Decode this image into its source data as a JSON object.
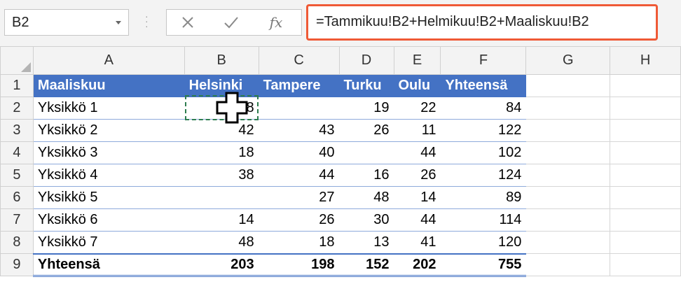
{
  "namebox": {
    "value": "B2"
  },
  "formula_bar": {
    "formula": "=Tammikuu!B2+Helmikuu!B2+Maaliskuu!B2",
    "fx_label": "fx"
  },
  "columns": [
    "A",
    "B",
    "C",
    "D",
    "E",
    "F",
    "G",
    "H"
  ],
  "header_row": {
    "row_num": "1",
    "cells": [
      "Maaliskuu",
      "Helsinki",
      "Tampere",
      "Turku",
      "Oulu",
      "Yhteensä"
    ]
  },
  "rows": [
    {
      "row_num": "2",
      "cells": [
        "Yksikkö 1",
        "8",
        "",
        "19",
        "22",
        "84"
      ]
    },
    {
      "row_num": "3",
      "cells": [
        "Yksikkö 2",
        "42",
        "43",
        "26",
        "11",
        "122"
      ]
    },
    {
      "row_num": "4",
      "cells": [
        "Yksikkö 3",
        "18",
        "40",
        "",
        "44",
        "102"
      ]
    },
    {
      "row_num": "5",
      "cells": [
        "Yksikkö 4",
        "38",
        "44",
        "16",
        "26",
        "124"
      ]
    },
    {
      "row_num": "6",
      "cells": [
        "Yksikkö 5",
        "",
        "27",
        "48",
        "14",
        "89"
      ]
    },
    {
      "row_num": "7",
      "cells": [
        "Yksikkö 6",
        "14",
        "26",
        "30",
        "44",
        "114"
      ]
    },
    {
      "row_num": "8",
      "cells": [
        "Yksikkö 7",
        "48",
        "18",
        "13",
        "41",
        "120"
      ]
    }
  ],
  "total_row": {
    "row_num": "9",
    "cells": [
      "Yhteensä",
      "203",
      "198",
      "152",
      "202",
      "755"
    ]
  },
  "selected_cell": "B2",
  "colors": {
    "header_fill": "#4472c4",
    "formula_highlight": "#ef5a36",
    "copy_marquee": "#2e7d4f"
  }
}
